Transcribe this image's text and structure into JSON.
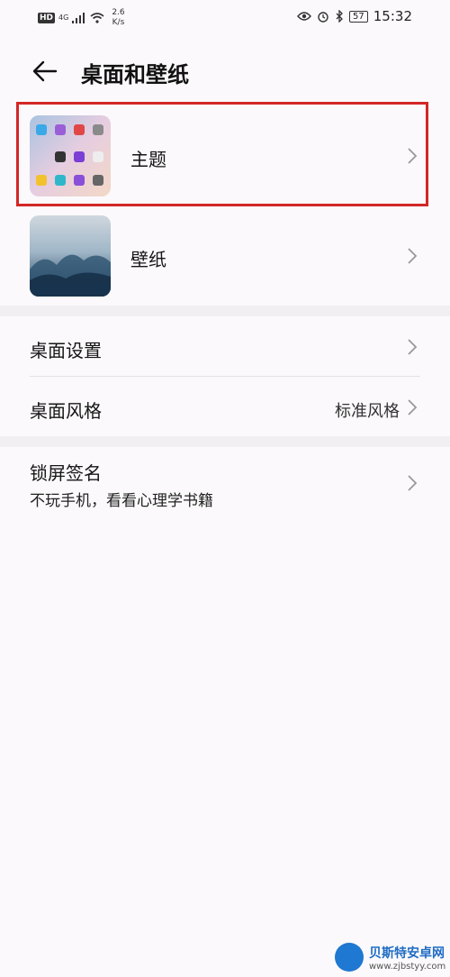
{
  "status_bar": {
    "hd": "HD",
    "network": "4G",
    "speed_value": "2.6",
    "speed_unit": "K/s",
    "battery": "57",
    "time": "15:32"
  },
  "header": {
    "title": "桌面和壁纸"
  },
  "items": {
    "theme": {
      "label": "主题"
    },
    "wallpaper": {
      "label": "壁纸"
    },
    "desktop_settings": {
      "label": "桌面设置"
    },
    "desktop_style": {
      "label": "桌面风格",
      "value": "标准风格"
    },
    "lock_signature": {
      "label": "锁屏签名",
      "value": "不玩手机，看看心理学书籍"
    }
  },
  "watermark": {
    "name": "贝斯特安卓网",
    "url": "www.zjbstyy.com"
  },
  "colors": {
    "highlight_border": "#d32626",
    "background": "#fbf9fb"
  }
}
